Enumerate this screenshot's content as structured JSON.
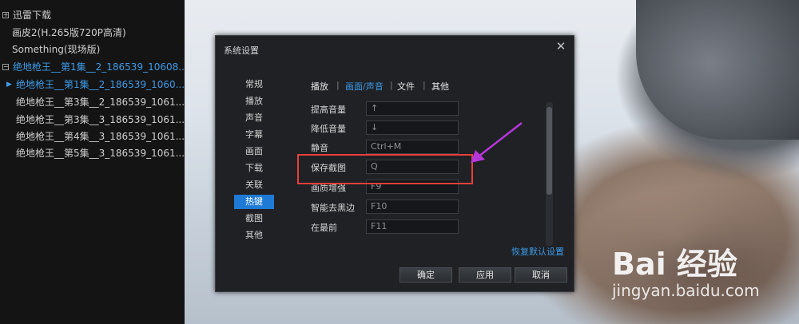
{
  "playlist": {
    "items": [
      {
        "kind": "group",
        "expander": "+",
        "label": "迅雷下载"
      },
      {
        "kind": "item",
        "label": "画皮2(H.265版720P高清)"
      },
      {
        "kind": "item",
        "label": "Something(现场版)"
      },
      {
        "kind": "group",
        "expander": "−",
        "label": "绝地枪王__第1集__2_186539_10608..."
      },
      {
        "kind": "active",
        "label": "绝地枪王__第1集__2_186539_1060..."
      },
      {
        "kind": "item",
        "label": "绝地枪王__第3集__2_186539_1061..."
      },
      {
        "kind": "item",
        "label": "绝地枪王__第3集__3_186539_1061..."
      },
      {
        "kind": "item",
        "label": "绝地枪王__第4集__3_186539_1061..."
      },
      {
        "kind": "item",
        "label": "绝地枪王__第5集__3_186539_1061..."
      }
    ],
    "pin_glyph": "✕"
  },
  "dialog": {
    "title": "系统设置",
    "close_glyph": "✕",
    "nav": [
      "常规",
      "播放",
      "声音",
      "字幕",
      "画面",
      "下载",
      "关联",
      "热键",
      "截图",
      "其他"
    ],
    "nav_selected": "热键",
    "tabs": [
      "播放",
      "画面/声音",
      "文件",
      "其他"
    ],
    "tab_selected": "画面/声音",
    "tab_separator": "|",
    "hotkeys": [
      {
        "label": "提高音量",
        "key": "↑"
      },
      {
        "label": "降低音量",
        "key": "↓"
      },
      {
        "label": "静音",
        "key": "Ctrl+M"
      },
      {
        "label": "保存截图",
        "key": "Q"
      },
      {
        "label": "画质增强",
        "key": "F9"
      },
      {
        "label": "智能去黑边",
        "key": "F10"
      },
      {
        "label": "在最前",
        "key": "F11"
      }
    ],
    "restore_defaults": "恢复默认设置",
    "buttons": {
      "ok": "确定",
      "apply": "应用",
      "cancel": "取消"
    }
  },
  "watermark": {
    "brand": "Bai 经验",
    "url": "jingyan.baidu.com"
  },
  "colors": {
    "accent": "#1f7ad6",
    "link": "#3d9be9",
    "annotation_box": "#e8403a",
    "annotation_arrow": "#b637d9"
  }
}
